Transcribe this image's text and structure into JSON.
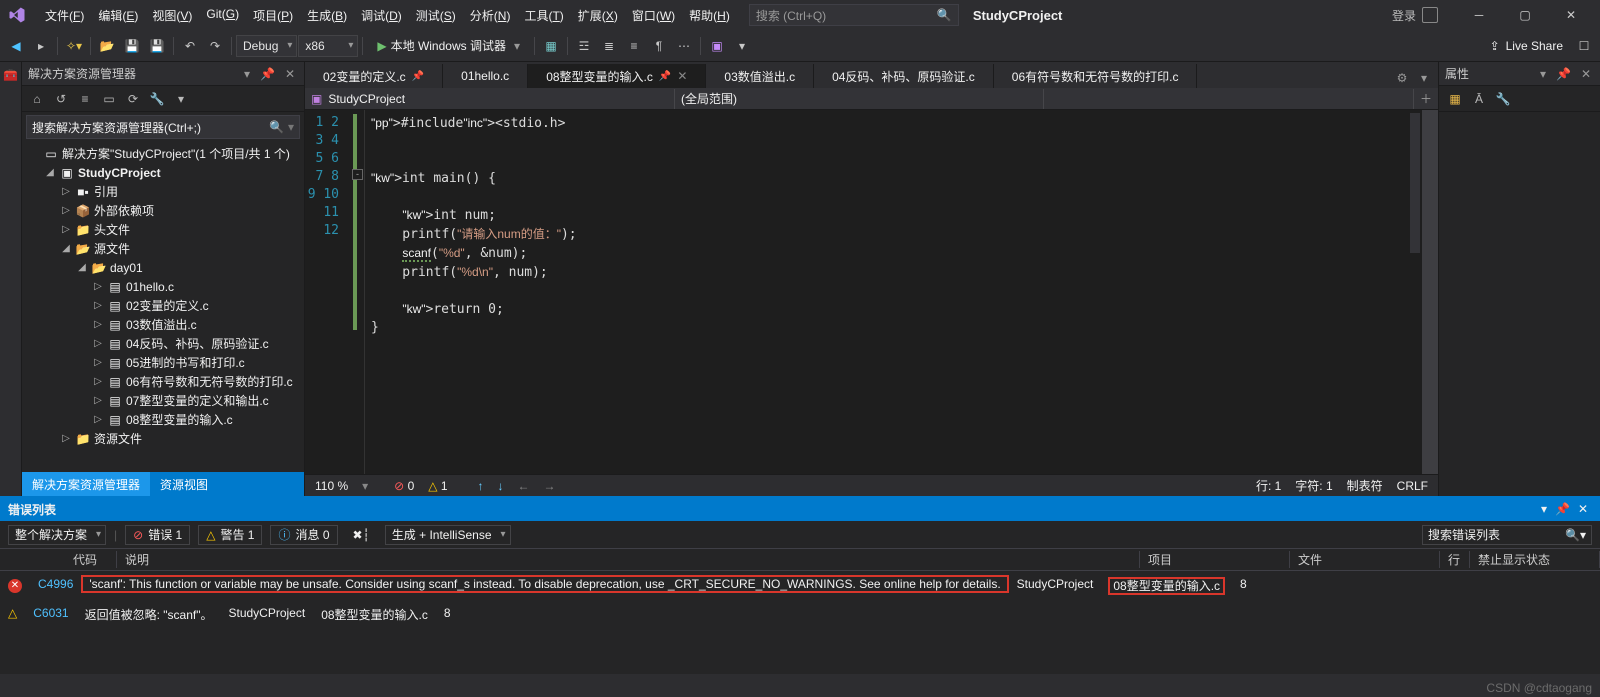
{
  "project_name": "StudyCProject",
  "titlebar": {
    "menus": [
      "文件(F)",
      "编辑(E)",
      "视图(V)",
      "Git(G)",
      "项目(P)",
      "生成(B)",
      "调试(D)",
      "测试(S)",
      "分析(N)",
      "工具(T)",
      "扩展(X)",
      "窗口(W)",
      "帮助(H)"
    ],
    "search_placeholder": "搜索 (Ctrl+Q)",
    "login": "登录"
  },
  "toolbar": {
    "config": "Debug",
    "platform": "x86",
    "run": "本地 Windows 调试器",
    "live_share": "Live Share"
  },
  "solution_explorer": {
    "title": "解决方案资源管理器",
    "search_placeholder": "搜索解决方案资源管理器(Ctrl+;)",
    "root": "解决方案\"StudyCProject\"(1 个项目/共 1 个)",
    "project": "StudyCProject",
    "children": [
      {
        "label": "引用",
        "icon": "■▪"
      },
      {
        "label": "外部依赖项",
        "icon": "📦"
      },
      {
        "label": "头文件",
        "icon": "📁"
      },
      {
        "label": "源文件",
        "icon": "📂",
        "expanded": true,
        "children": [
          {
            "label": "day01",
            "icon": "📂",
            "expanded": true,
            "children": [
              {
                "label": "01hello.c"
              },
              {
                "label": "02变量的定义.c"
              },
              {
                "label": "03数值溢出.c"
              },
              {
                "label": "04反码、补码、原码验证.c"
              },
              {
                "label": "05进制的书写和打印.c"
              },
              {
                "label": "06有符号数和无符号数的打印.c"
              },
              {
                "label": "07整型变量的定义和输出.c"
              },
              {
                "label": "08整型变量的输入.c"
              }
            ]
          }
        ]
      },
      {
        "label": "资源文件",
        "icon": "📁"
      }
    ],
    "bottom_tabs": [
      "解决方案资源管理器",
      "资源视图"
    ]
  },
  "tabs": [
    {
      "label": "02变量的定义.c",
      "pinned": true
    },
    {
      "label": "01hello.c"
    },
    {
      "label": "08整型变量的输入.c",
      "active": true,
      "pinned": true,
      "closeable": true
    },
    {
      "label": "03数值溢出.c"
    },
    {
      "label": "04反码、补码、原码验证.c"
    },
    {
      "label": "06有符号数和无符号数的打印.c"
    }
  ],
  "navbar": {
    "project": "StudyCProject",
    "scope": "(全局范围)"
  },
  "code": {
    "lines": [
      "#include<stdio.h>",
      "",
      "",
      "int main() {",
      "",
      "    int num;",
      "    printf(\"请输入num的值：\");",
      "    scanf(\"%d\", &num);",
      "    printf(\"%d\\n\", num);",
      "",
      "    return 0;",
      "}"
    ]
  },
  "editor_status": {
    "zoom": "110 %",
    "errors": "0",
    "warnings": "1",
    "line": "行: 1",
    "col": "字符: 1",
    "tab": "制表符",
    "enc": "CRLF"
  },
  "properties": {
    "title": "属性"
  },
  "error_list": {
    "title": "错误列表",
    "scope": "整个解决方案",
    "errors_pill": "错误 1",
    "warnings_pill": "警告 1",
    "info_pill": "消息 0",
    "build_combo": "生成 + IntelliSense",
    "search_placeholder": "搜索错误列表",
    "columns": [
      "",
      "代码",
      "说明",
      "项目",
      "文件",
      "行",
      "禁止显示状态"
    ],
    "rows": [
      {
        "sev": "error",
        "code": "C4996",
        "desc": "'scanf': This function or variable may be unsafe. Consider using scanf_s instead. To disable deprecation, use _CRT_SECURE_NO_WARNINGS. See online help for details.",
        "project": "StudyCProject",
        "file": "08整型变量的输入.c",
        "line": "8",
        "highlight": true
      },
      {
        "sev": "warning",
        "code": "C6031",
        "desc": "返回值被忽略: \"scanf\"。",
        "project": "StudyCProject",
        "file": "08整型变量的输入.c",
        "line": "8"
      }
    ]
  },
  "watermark": "CSDN @cdtaogang"
}
